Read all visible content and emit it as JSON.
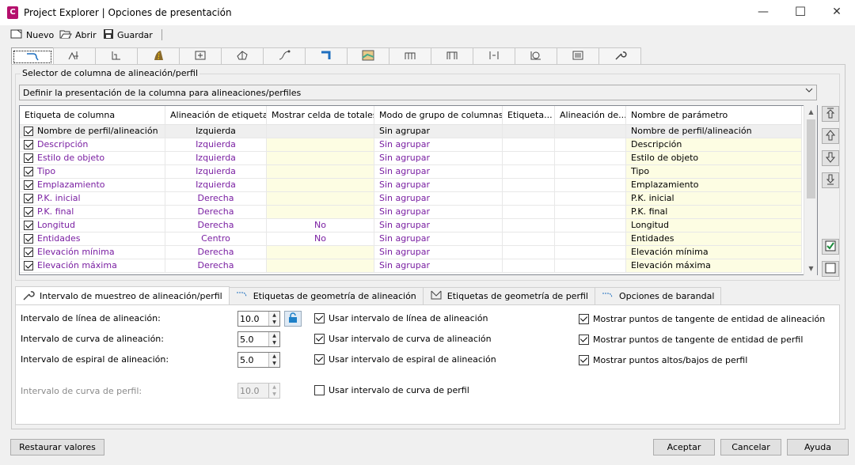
{
  "window": {
    "app_icon_letter": "C",
    "title": "Project Explorer | Opciones de presentación",
    "minimize": "—",
    "maximize": "☐",
    "close": "✕"
  },
  "toolbar": {
    "new_label": "Nuevo",
    "open_label": "Abrir",
    "save_label": "Guardar"
  },
  "icon_tabs": [
    "alignment-icon",
    "profile-icon",
    "profile-view-icon",
    "corridor-icon",
    "sample-line-icon",
    "surface-icon",
    "pipe-network-icon",
    "structure-icon",
    "catchment-icon",
    "assembly-icon",
    "subassembly-icon",
    "label-icon",
    "point-icon",
    "sheet-icon",
    "settings-wrench-icon"
  ],
  "selector": {
    "group_label": "Selector de columna de alineación/perfil",
    "combo_value": "Definir la presentación de la columna para alineaciones/perfiles"
  },
  "grid": {
    "columns": [
      "Etiqueta de columna",
      "Alineación de etiqueta",
      "Mostrar celda de totales",
      "Modo de grupo de columnas",
      "Etiqueta...",
      "Alineación de...",
      "Nombre de parámetro"
    ],
    "rows": [
      {
        "checked": true,
        "label": "Nombre de perfil/alineación",
        "align": "Izquierda",
        "totals": "",
        "group": "Sin agrupar",
        "param": "Nombre de perfil/alineación"
      },
      {
        "checked": true,
        "label": "Descripción",
        "align": "Izquierda",
        "totals": "",
        "group": "Sin agrupar",
        "param": "Descripción"
      },
      {
        "checked": true,
        "label": "Estilo de objeto",
        "align": "Izquierda",
        "totals": "",
        "group": "Sin agrupar",
        "param": "Estilo de objeto"
      },
      {
        "checked": true,
        "label": "Tipo",
        "align": "Izquierda",
        "totals": "",
        "group": "Sin agrupar",
        "param": "Tipo"
      },
      {
        "checked": true,
        "label": "Emplazamiento",
        "align": "Izquierda",
        "totals": "",
        "group": "Sin agrupar",
        "param": "Emplazamiento"
      },
      {
        "checked": true,
        "label": "P.K. inicial",
        "align": "Derecha",
        "totals": "",
        "group": "Sin agrupar",
        "param": "P.K. inicial"
      },
      {
        "checked": true,
        "label": "P.K. final",
        "align": "Derecha",
        "totals": "",
        "group": "Sin agrupar",
        "param": "P.K. final"
      },
      {
        "checked": true,
        "label": "Longitud",
        "align": "Derecha",
        "totals": "No",
        "group": "Sin agrupar",
        "param": "Longitud"
      },
      {
        "checked": true,
        "label": "Entidades",
        "align": "Centro",
        "totals": "No",
        "group": "Sin agrupar",
        "param": "Entidades"
      },
      {
        "checked": true,
        "label": "Elevación mínima",
        "align": "Derecha",
        "totals": "",
        "group": "Sin agrupar",
        "param": "Elevación mínima"
      },
      {
        "checked": true,
        "label": "Elevación máxima",
        "align": "Derecha",
        "totals": "",
        "group": "Sin agrupar",
        "param": "Elevación máxima"
      }
    ]
  },
  "subtabs": {
    "tab1": "Intervalo de muestreo de alineación/perfil",
    "tab2": "Etiquetas de geometría de alineación",
    "tab3": "Etiquetas de geometría de perfil",
    "tab4": "Opciones de barandal"
  },
  "sampling": {
    "line_label": "Intervalo de línea de alineación:",
    "line_value": "10.0",
    "curve_label": "Intervalo de curva de alineación:",
    "curve_value": "5.0",
    "spiral_label": "Intervalo de espiral de alineación:",
    "spiral_value": "5.0",
    "profile_curve_label": "Intervalo de curva de perfil:",
    "profile_curve_value": "10.0",
    "use_line": "Usar intervalo de línea de alineación",
    "use_curve": "Usar intervalo de curva de alineación",
    "use_spiral": "Usar intervalo de espiral de alineación",
    "use_profile_curve": "Usar intervalo de curva de perfil",
    "show_alignment_tangent": "Mostrar puntos de tangente de entidad de alineación",
    "show_profile_tangent": "Mostrar puntos de tangente de entidad de perfil",
    "show_high_low": "Mostrar puntos altos/bajos de perfil"
  },
  "buttons": {
    "restore": "Restaurar valores",
    "accept": "Aceptar",
    "cancel": "Cancelar",
    "help": "Ayuda"
  }
}
